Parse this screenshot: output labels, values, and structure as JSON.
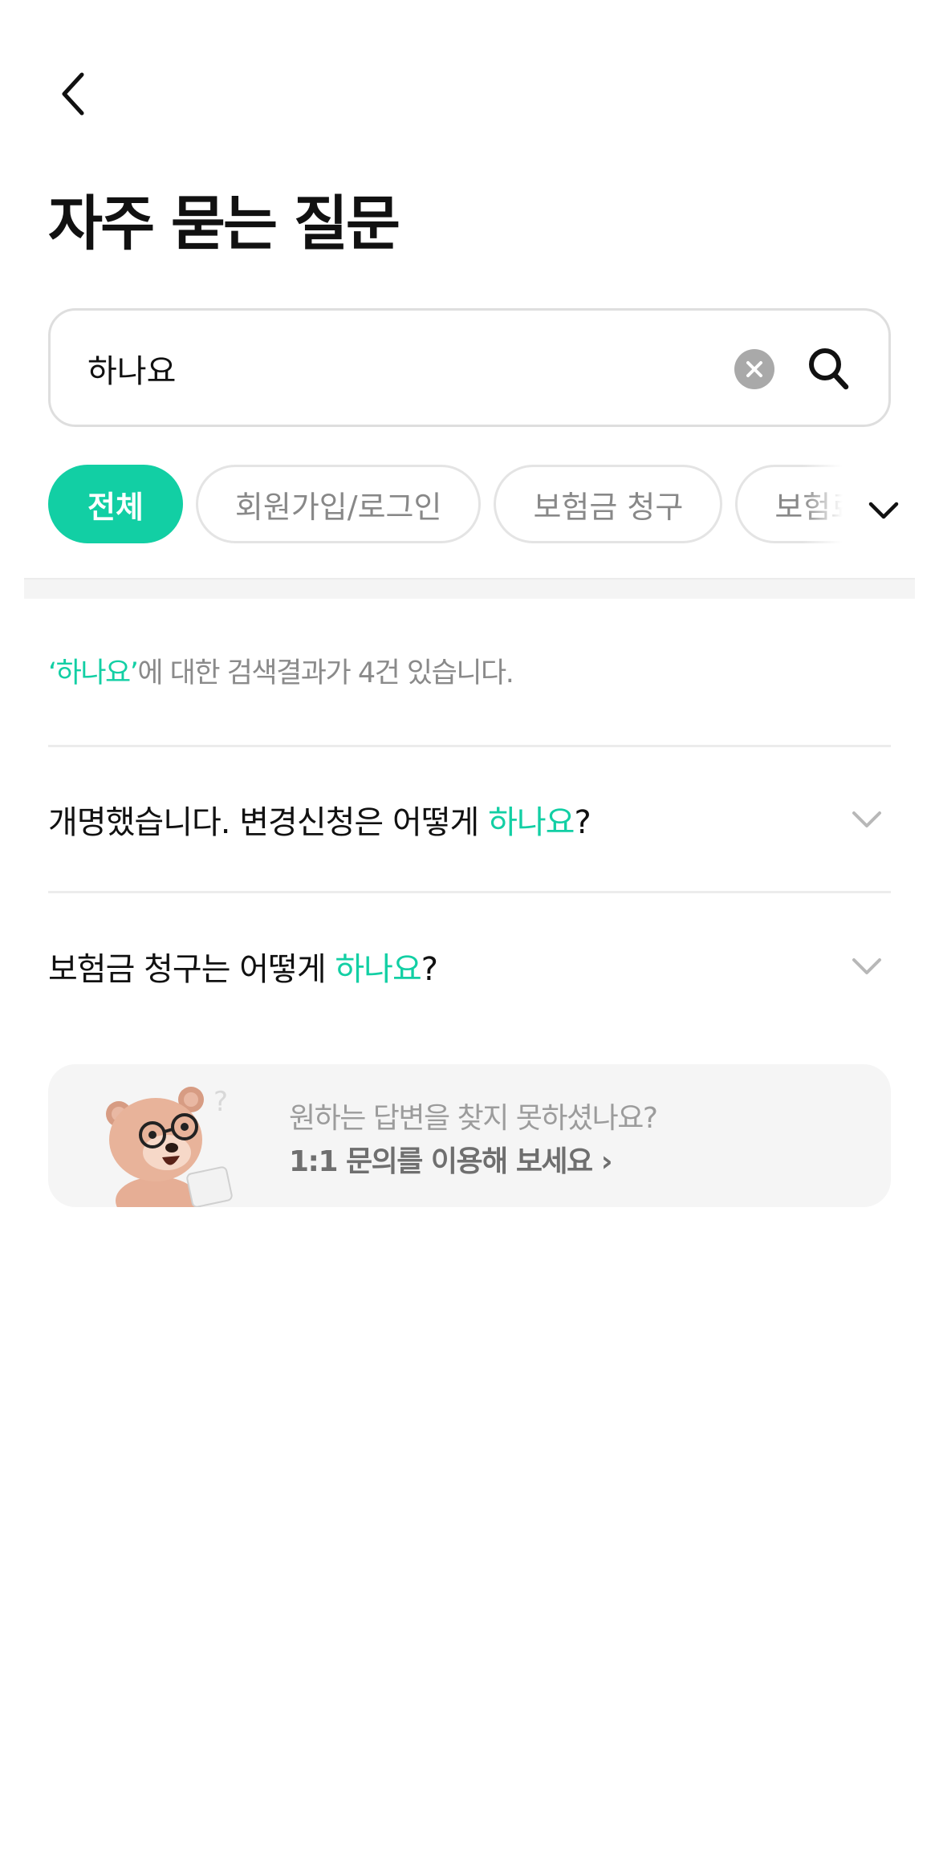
{
  "header": {
    "back_icon": "chevron-left-icon",
    "title": "자주 묻는 질문"
  },
  "search": {
    "value": "하나요",
    "clear_icon": "close-circle-icon",
    "search_icon": "search-icon"
  },
  "categories": {
    "items": [
      {
        "label": "전체",
        "active": true
      },
      {
        "label": "회원가입/로그인",
        "active": false
      },
      {
        "label": "보험금 청구",
        "active": false
      },
      {
        "label": "보험료",
        "active": false
      }
    ],
    "expand_icon": "chevron-down-icon"
  },
  "results": {
    "keyword_quoted": "‘하나요’",
    "summary_suffix": "에 대한 검색결과가 4건 있습니다."
  },
  "faqs": [
    {
      "prefix": "개명했습니다. 변경신청은 어떻게 ",
      "keyword": "하나요",
      "suffix": "?"
    },
    {
      "prefix": "보험금 청구는 어떻게 ",
      "keyword": "하나요",
      "suffix": "?"
    }
  ],
  "banner": {
    "line1": "원하는 답변을 찾지 못하셨나요?",
    "line2": "1:1 문의를 이용해 보세요 ›",
    "mascot_icon": "bear-mascot-illustration"
  },
  "colors": {
    "accent": "#12cfa4",
    "text_primary": "#111111",
    "text_muted": "#8a8a8a",
    "border": "#dedede",
    "banner_bg": "#f5f5f5"
  }
}
